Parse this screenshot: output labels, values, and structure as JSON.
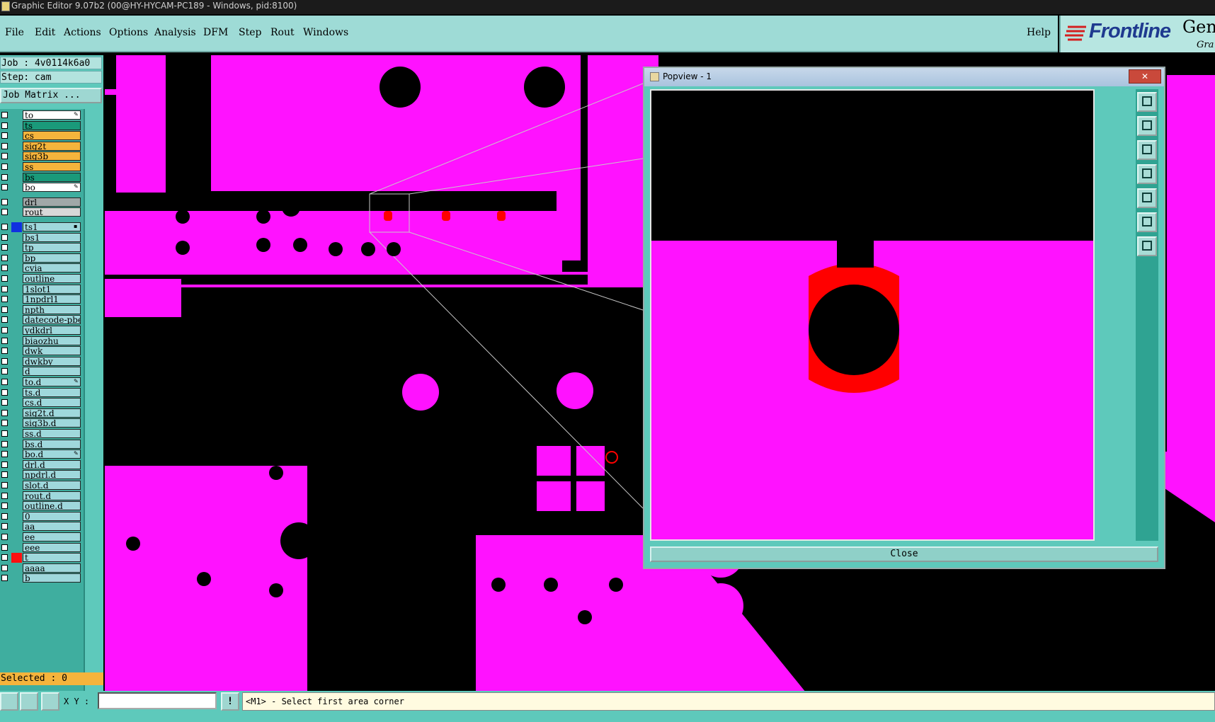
{
  "window": {
    "title": "Graphic Editor 9.07b2 (00@HY-HYCAM-PC189 - Windows, pid:8100)"
  },
  "menu": {
    "items": [
      "File",
      "Edit",
      "Actions",
      "Options",
      "Analysis",
      "DFM",
      "Step",
      "Rout",
      "Windows"
    ],
    "help": "Help"
  },
  "logo": {
    "brand": "Frontline",
    "product": "Gene",
    "sub": "Gra"
  },
  "job": {
    "job_label": "Job : 4v0114k6a0",
    "step_label": "Step: cam",
    "matrix_button": "Job Matrix ..."
  },
  "layers": [
    {
      "name": "to",
      "color": "#ffffff",
      "mark": "edit"
    },
    {
      "name": "ts",
      "color": "#1a9a7a"
    },
    {
      "name": "cs",
      "color": "#f5b43c"
    },
    {
      "name": "sig2t",
      "color": "#f5b43c"
    },
    {
      "name": "sig3b",
      "color": "#f5b43c"
    },
    {
      "name": "ss",
      "color": "#f5b43c"
    },
    {
      "name": "bs",
      "color": "#1a9a7a"
    },
    {
      "name": "bo",
      "color": "#ffffff",
      "mark": "edit"
    },
    {
      "name": "drl",
      "color": "#a0a8a8"
    },
    {
      "name": "rout",
      "color": "#d8d8d8"
    },
    {
      "name": "ts1",
      "color": "#9fd8dc",
      "swatch": "#1030e0",
      "mark": "sel"
    },
    {
      "name": "bs1",
      "color": "#9fd8dc"
    },
    {
      "name": "tp",
      "color": "#9fd8dc"
    },
    {
      "name": "bp",
      "color": "#9fd8dc"
    },
    {
      "name": "cvia",
      "color": "#9fd8dc"
    },
    {
      "name": "outline",
      "color": "#9fd8dc"
    },
    {
      "name": "1slot1",
      "color": "#9fd8dc"
    },
    {
      "name": "1npdrl1",
      "color": "#9fd8dc"
    },
    {
      "name": "npth",
      "color": "#9fd8dc"
    },
    {
      "name": "datecode-pbe",
      "color": "#9fd8dc"
    },
    {
      "name": "ydkdrl",
      "color": "#9fd8dc"
    },
    {
      "name": "biaozhu",
      "color": "#9fd8dc"
    },
    {
      "name": "dwk",
      "color": "#9fd8dc"
    },
    {
      "name": "dwkby",
      "color": "#9fd8dc"
    },
    {
      "name": "d",
      "color": "#9fd8dc"
    },
    {
      "name": "to.d",
      "color": "#9fd8dc",
      "mark": "edit"
    },
    {
      "name": "ts.d",
      "color": "#9fd8dc"
    },
    {
      "name": "cs.d",
      "color": "#9fd8dc"
    },
    {
      "name": "sig2t.d",
      "color": "#9fd8dc"
    },
    {
      "name": "sig3b.d",
      "color": "#9fd8dc"
    },
    {
      "name": "ss.d",
      "color": "#9fd8dc"
    },
    {
      "name": "bs.d",
      "color": "#9fd8dc"
    },
    {
      "name": "bo.d",
      "color": "#9fd8dc",
      "mark": "edit"
    },
    {
      "name": "drl.d",
      "color": "#9fd8dc"
    },
    {
      "name": "npdrl.d",
      "color": "#9fd8dc"
    },
    {
      "name": "slot.d",
      "color": "#9fd8dc"
    },
    {
      "name": "rout.d",
      "color": "#9fd8dc"
    },
    {
      "name": "outline.d",
      "color": "#9fd8dc"
    },
    {
      "name": "0",
      "color": "#9fd8dc"
    },
    {
      "name": "aa",
      "color": "#9fd8dc"
    },
    {
      "name": "ee",
      "color": "#9fd8dc"
    },
    {
      "name": "eee",
      "color": "#9fd8dc"
    },
    {
      "name": "t",
      "color": "#9fd8dc",
      "swatch": "#ff1010"
    },
    {
      "name": "aaaa",
      "color": "#9fd8dc"
    },
    {
      "name": "b",
      "color": "#9fd8dc"
    }
  ],
  "selected_label": "Selected : 0",
  "popview": {
    "title": "Popview - 1",
    "close_x": "✕",
    "close_button": "Close"
  },
  "status": {
    "xy_label": "X Y :",
    "xy_value": "",
    "bang": "!",
    "prompt": "<M1> - Select first area corner"
  },
  "colors": {
    "feature": "#ff12ff",
    "highlight": "#ff0000",
    "panel": "#5ec9bb"
  }
}
